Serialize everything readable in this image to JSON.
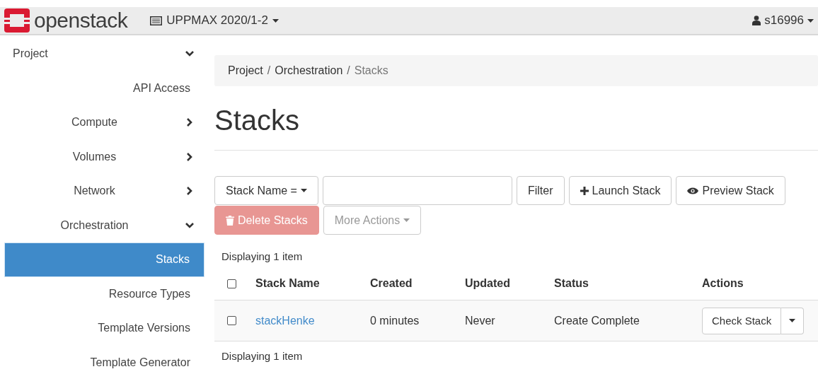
{
  "navbar": {
    "brand": "openstack",
    "project": "UPPMAX 2020/1-2",
    "user": "s16996"
  },
  "sidebar": {
    "items": [
      {
        "label": "Project",
        "expanded": true,
        "selected": false,
        "children": [
          {
            "label": "API Access",
            "selected": false
          },
          {
            "label": "Compute",
            "kind": "group",
            "expanded": false,
            "selected": false
          },
          {
            "label": "Volumes",
            "kind": "group",
            "expanded": false,
            "selected": false
          },
          {
            "label": "Network",
            "kind": "group",
            "expanded": false,
            "selected": false
          },
          {
            "label": "Orchestration",
            "expanded": true,
            "selected": false,
            "children": [
              {
                "label": "Stacks",
                "selected": true
              },
              {
                "label": "Resource Types",
                "selected": false
              },
              {
                "label": "Template Versions",
                "selected": false
              },
              {
                "label": "Template Generator",
                "selected": false
              }
            ]
          }
        ]
      }
    ]
  },
  "breadcrumb": [
    "Project",
    "Orchestration",
    "Stacks"
  ],
  "breadcrumb_separator": "/",
  "page_title": "Stacks",
  "toolbar": {
    "filter_select": "Stack Name =",
    "filter_button": "Filter",
    "buttons": [
      {
        "kind": "launch",
        "label": "Launch Stack",
        "disabled": false
      },
      {
        "kind": "preview",
        "label": "Preview Stack",
        "disabled": false
      },
      {
        "kind": "delete",
        "label": "Delete Stacks",
        "disabled": true
      },
      {
        "kind": "more",
        "label": "More Actions",
        "disabled": true
      }
    ]
  },
  "table": {
    "count_top": "Displaying 1 item",
    "select_all_checked": false,
    "columns": [
      "Stack Name",
      "Created",
      "Updated",
      "Status",
      "Actions"
    ],
    "rows": [
      {
        "checked": false,
        "name": "stackHenke",
        "created": "0 minutes",
        "updated": "Never",
        "status": "Create Complete",
        "action": "Check Stack"
      }
    ],
    "count_bottom": "Displaying 1 item"
  }
}
